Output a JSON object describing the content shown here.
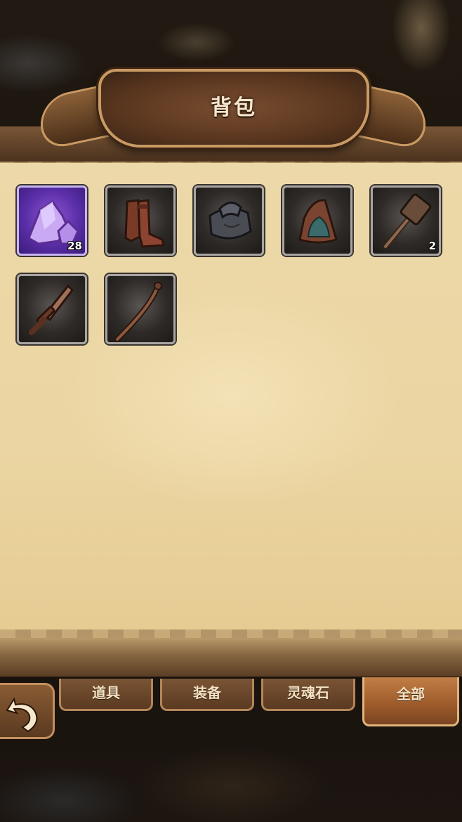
{
  "title": "背包",
  "items": [
    {
      "name": "purple crystal ore",
      "icon": "purple-crystal-icon",
      "count": "28",
      "rarity": "purple"
    },
    {
      "name": "leather boots",
      "icon": "boots-icon",
      "count": "",
      "rarity": "normal"
    },
    {
      "name": "dark scarf",
      "icon": "scarf-icon",
      "count": "",
      "rarity": "normal"
    },
    {
      "name": "leather hood",
      "icon": "hood-icon",
      "count": "",
      "rarity": "normal"
    },
    {
      "name": "wooden hammer",
      "icon": "hammer-icon",
      "count": "2",
      "rarity": "normal"
    },
    {
      "name": "wooden dagger",
      "icon": "dagger-icon",
      "count": "",
      "rarity": "normal"
    },
    {
      "name": "wooden staff",
      "icon": "staff-icon",
      "count": "",
      "rarity": "normal"
    }
  ],
  "tabs": [
    {
      "label": "道具",
      "active": false
    },
    {
      "label": "装备",
      "active": false
    },
    {
      "label": "灵魂石",
      "active": false
    },
    {
      "label": "全部",
      "active": true
    }
  ],
  "back_icon": "return-arrow-icon",
  "colors": {
    "parchment": "#ebd5a2",
    "wood": "#5a3a22",
    "active_tab": "#b06a34",
    "purple_rarity": "#6a3cb8"
  }
}
